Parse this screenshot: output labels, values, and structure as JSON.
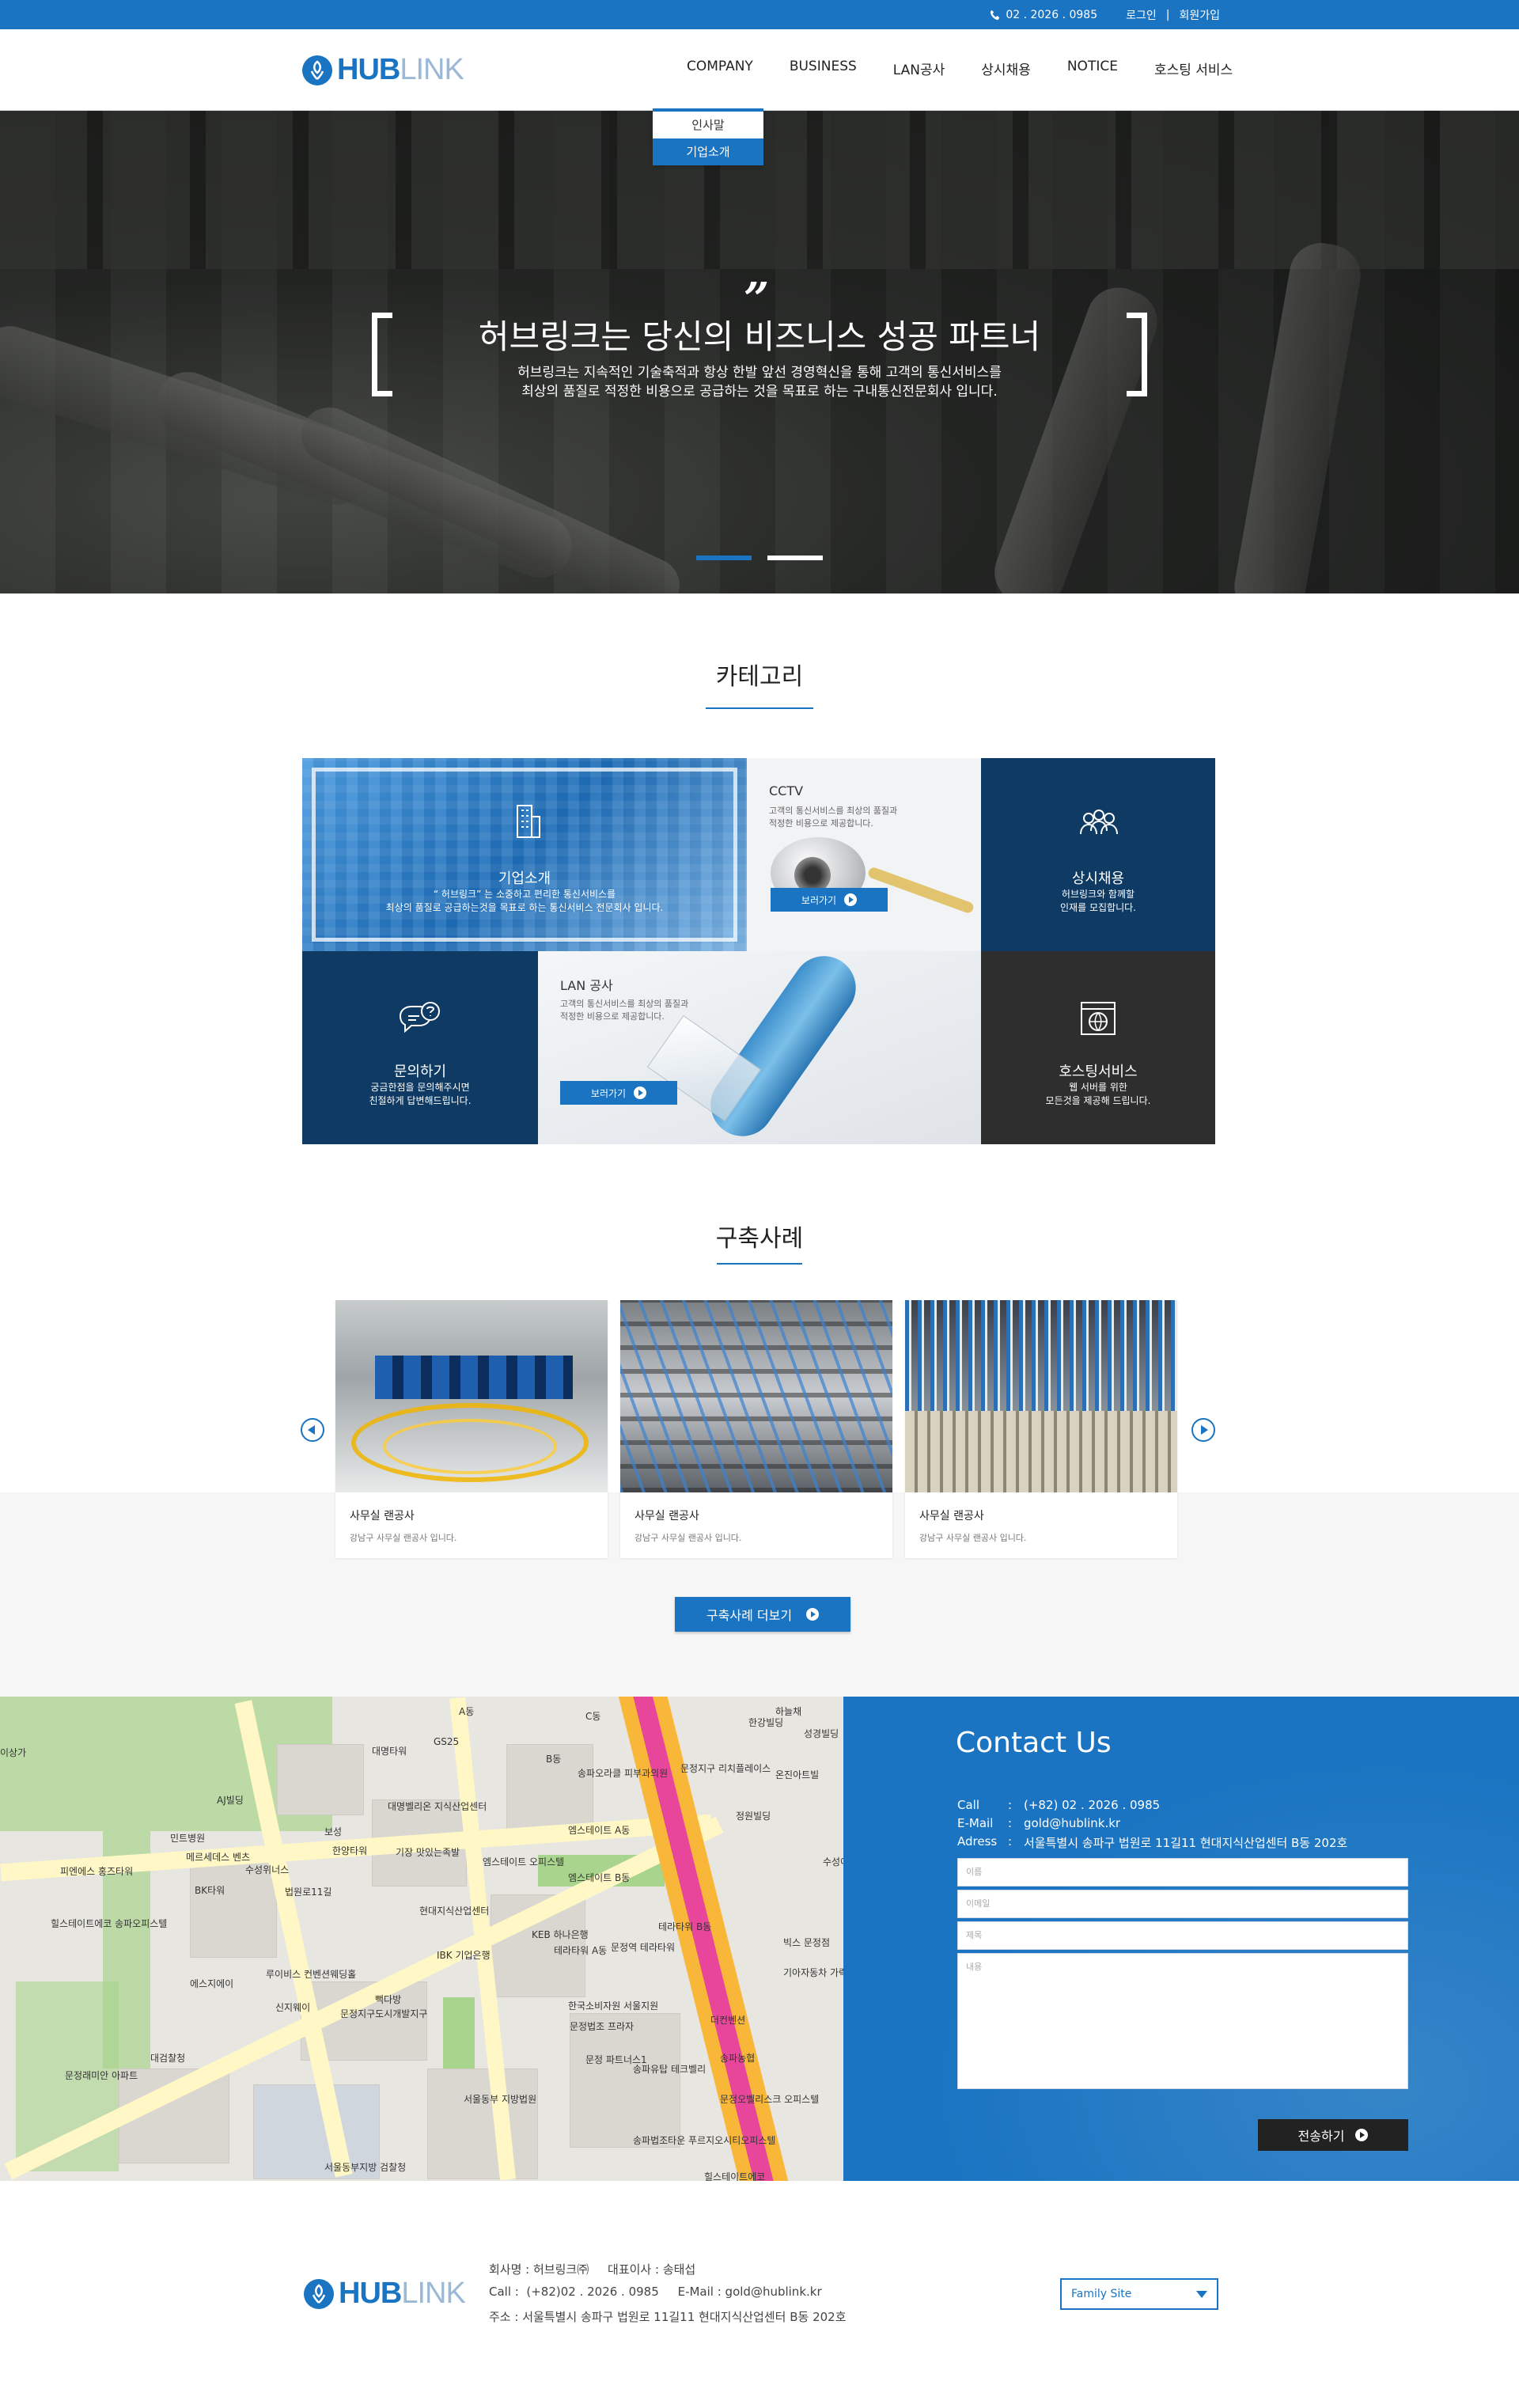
{
  "topbar": {
    "phone": "02 . 2026 . 0985",
    "login": "로그인",
    "separator": "|",
    "signup": "회원가입"
  },
  "header": {
    "logo_hub": "HUB",
    "logo_link": "LINK"
  },
  "nav": [
    "COMPANY",
    "BUSINESS",
    "LAN공사",
    "상시채용",
    "NOTICE",
    "호스팅 서비스"
  ],
  "dropdown": [
    "인사말",
    "기업소개"
  ],
  "hero": {
    "quote_mark": "”",
    "title": "허브링크는 당신의 비즈니스 성공 파트너",
    "line1": "허브링크는 지속적인 기술축적과 항상 한발 앞선 경영혁신을 통해 고객의 통신서비스를",
    "line2": "최상의 품질로 적정한 비용으로 공급하는 것을 목표로 하는 구내통신전문회사 입니다."
  },
  "category": {
    "title": "카테고리",
    "company": {
      "title": "기업소개",
      "desc1": "“ 허브링크” 는 소중하고 편리한 통신서비스를",
      "desc2": "최상의 품질로 공급하는것을 목표로 하는 통신서비스 전문회사 입니다."
    },
    "cctv": {
      "title": "CCTV",
      "desc1": "고객의 통신서비스를 최상의 품질과",
      "desc2": "적정한 비용으로 제공합니다.",
      "btn": "보러가기"
    },
    "recruit": {
      "title": "상시채용",
      "desc1": "허브링크와 함께할",
      "desc2": "인재를 모집합니다."
    },
    "inquiry": {
      "title": "문의하기",
      "desc1": "궁금한점을 문의해주시면",
      "desc2": "친절하게 답변해드립니다."
    },
    "lan": {
      "title": "LAN 공사",
      "desc1": "고객의 통신서비스를 최상의 품질과",
      "desc2": "적정한 비용으로 제공합니다.",
      "btn": "보러가기"
    },
    "hosting": {
      "title": "호스팅서비스",
      "desc1": "웹 서버를 위한",
      "desc2": "모든것을 제공해 드립니다."
    }
  },
  "cases": {
    "title": "구축사례",
    "items": [
      {
        "title": "사무실 랜공사",
        "desc": "강남구 사무실 랜공사 입니다."
      },
      {
        "title": "사무실 랜공사",
        "desc": "강남구 사무실 랜공사 입니다."
      },
      {
        "title": "사무실 랜공사",
        "desc": "강남구 사무실 랜공사 입니다."
      }
    ],
    "more_btn": "구축사례 더보기"
  },
  "map": {
    "labels": [
      "대명타워",
      "A동",
      "B동",
      "C동",
      "GS25",
      "송파오라클 피부과의원",
      "하늘채",
      "현대지식산업센터",
      "AJ빌딩",
      "보성",
      "한양타워",
      "대명벨리온 지식산업센터",
      "민트병원",
      "메르세데스 벤츠",
      "수성위너스",
      "BK타워",
      "법원로11길",
      "기장 맛있는족발",
      "피엔에스 홍즈타워",
      "힐스테이트에코 송파오피스텔",
      "엠스테이트 A동",
      "엠스테이트 B동",
      "엠스테이트 오피스텔",
      "KEB 하나은행",
      "테라타워 B동",
      "문정역 테라타워",
      "테라타워 A동",
      "IBK 기업은행",
      "루이비스 컨벤션웨딩홀",
      "에스지에이",
      "신지웨이",
      "문정지구도시개발지구",
      "대검찰청",
      "문정래미안 아파트",
      "서울동부 지방법원",
      "서울동부지방 검찰청",
      "한국소비자원 서울지원",
      "문정법조 프라자",
      "문정 파트너스1",
      "송파유탑 테크벨리",
      "송파농협",
      "문정오벨리스크 오피스텔",
      "송파법조타운 푸르지오시티오피스텔",
      "힐스테이트에코",
      "기아자동차 가락지점",
      "더컨벤션",
      "문정지구 리치플레이스",
      "정원빌딩",
      "수성아트빌",
      "한강빌딩",
      "성경빌딩",
      "온진아트빌",
      "이상가",
      "빅스 문정점",
      "뻑다방"
    ]
  },
  "contact": {
    "title": "Contact Us",
    "call_label": "Call",
    "call": "(+82) 02 . 2026 . 0985",
    "email_label": "E-Mail",
    "email": "gold@hublink.kr",
    "address_label": "Adress",
    "address": "서울특별시 송파구 법원로 11길11 현대지식산업센터 B동 202호",
    "colon": ":",
    "fields": [
      "이름",
      "이메일",
      "제목",
      "내용"
    ],
    "send": "전송하기"
  },
  "footer": {
    "logo_hub": "HUB",
    "logo_link": "LINK",
    "line1": "회사명 : 허브링크㈜     대표이사 : 송태섭",
    "line2": "Call :  (+82)02 . 2026 . 0985     E-Mail : gold@hublink.kr",
    "line3": "주소 : 서울특별시 송파구 법원로 11길11 현대지식산업센터 B동 202호",
    "family_site": "Family Site"
  },
  "colors": {
    "brand": "#1a74c1",
    "navy": "#0f3a63",
    "dark": "#2e2e2e"
  }
}
